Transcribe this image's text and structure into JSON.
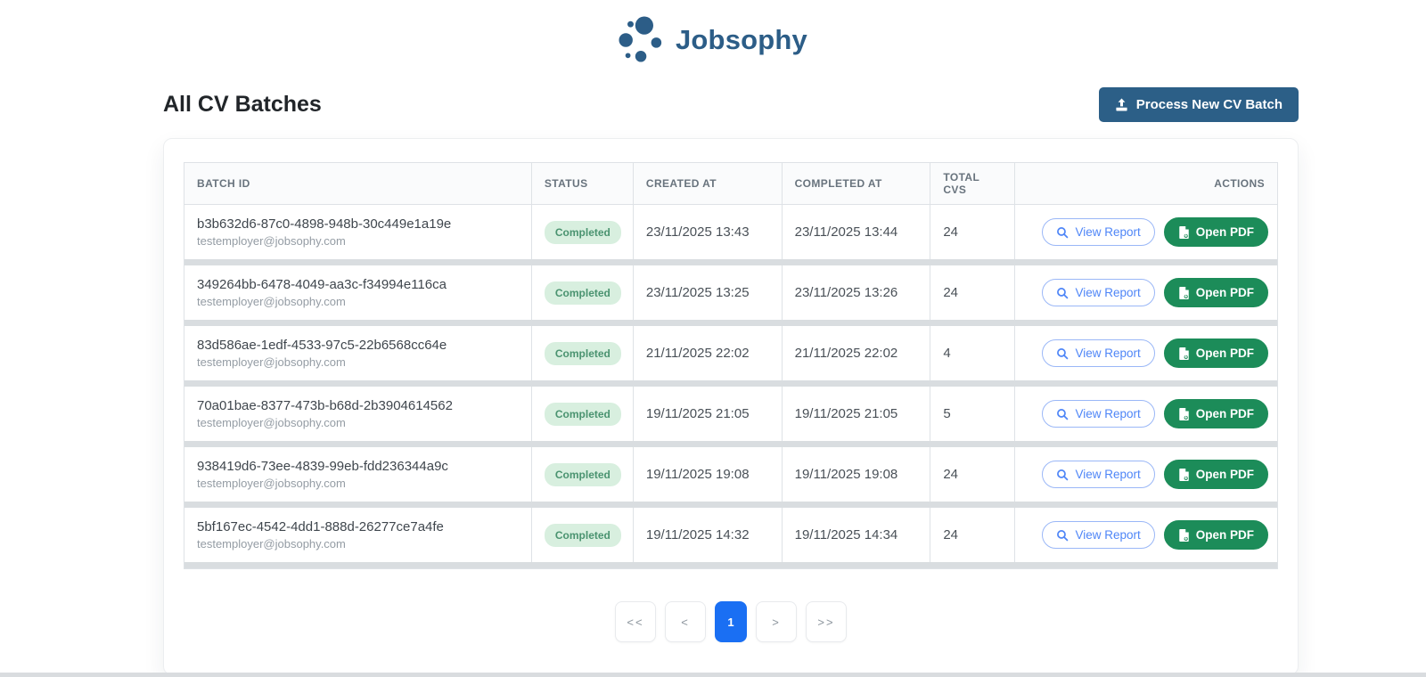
{
  "brand": {
    "name": "Jobsophy"
  },
  "page": {
    "title": "All CV Batches"
  },
  "toolbar": {
    "process_button_label": "Process New CV Batch"
  },
  "table": {
    "headers": {
      "batch_id": "BATCH ID",
      "status": "STATUS",
      "created_at": "CREATED AT",
      "completed_at": "COMPLETED AT",
      "total_cvs": "TOTAL CVS",
      "actions": "ACTIONS"
    },
    "actions": {
      "view_report": "View Report",
      "open_pdf": "Open PDF"
    },
    "rows": [
      {
        "batch_id": "b3b632d6-87c0-4898-948b-30c449e1a19e",
        "email": "testemployer@jobsophy.com",
        "status": "Completed",
        "created_at": "23/11/2025 13:43",
        "completed_at": "23/11/2025 13:44",
        "total_cvs": "24"
      },
      {
        "batch_id": "349264bb-6478-4049-aa3c-f34994e116ca",
        "email": "testemployer@jobsophy.com",
        "status": "Completed",
        "created_at": "23/11/2025 13:25",
        "completed_at": "23/11/2025 13:26",
        "total_cvs": "24"
      },
      {
        "batch_id": "83d586ae-1edf-4533-97c5-22b6568cc64e",
        "email": "testemployer@jobsophy.com",
        "status": "Completed",
        "created_at": "21/11/2025 22:02",
        "completed_at": "21/11/2025 22:02",
        "total_cvs": "4"
      },
      {
        "batch_id": "70a01bae-8377-473b-b68d-2b3904614562",
        "email": "testemployer@jobsophy.com",
        "status": "Completed",
        "created_at": "19/11/2025 21:05",
        "completed_at": "19/11/2025 21:05",
        "total_cvs": "5"
      },
      {
        "batch_id": "938419d6-73ee-4839-99eb-fdd236344a9c",
        "email": "testemployer@jobsophy.com",
        "status": "Completed",
        "created_at": "19/11/2025 19:08",
        "completed_at": "19/11/2025 19:08",
        "total_cvs": "24"
      },
      {
        "batch_id": "5bf167ec-4542-4dd1-888d-26277ce7a4fe",
        "email": "testemployer@jobsophy.com",
        "status": "Completed",
        "created_at": "19/11/2025 14:32",
        "completed_at": "19/11/2025 14:34",
        "total_cvs": "24"
      }
    ]
  },
  "pagination": {
    "first": "<<",
    "prev": "<",
    "current_page": "1",
    "next": ">",
    "last": ">>"
  },
  "colors": {
    "brand_blue": "#2c5d87",
    "button_dark_blue": "#2c5f87",
    "badge_green_bg": "#d8efdf",
    "badge_green_text": "#4a9370",
    "open_pdf_green": "#1c8c59",
    "view_report_blue": "#4f86f7",
    "active_page_blue": "#1a6ff3"
  }
}
